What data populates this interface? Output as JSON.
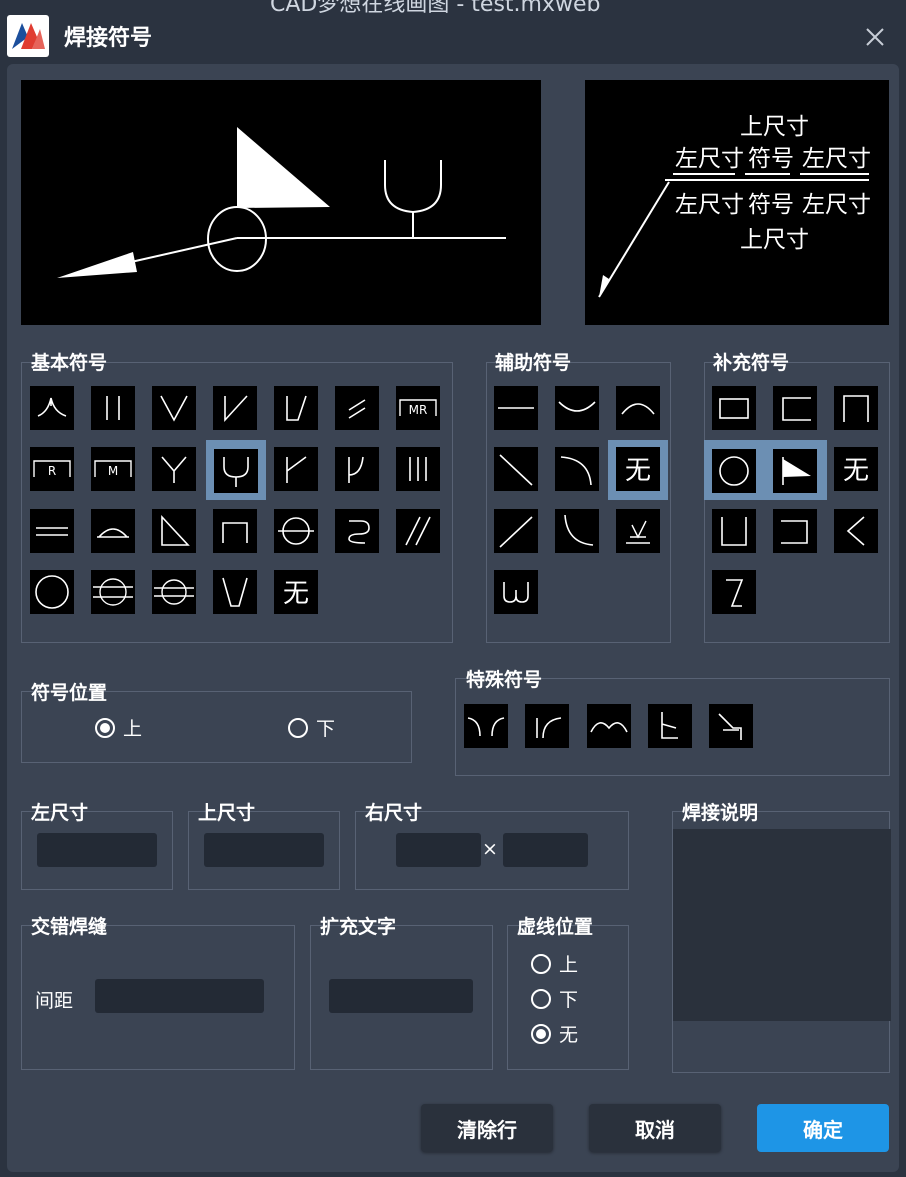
{
  "window": {
    "title": "焊接符号",
    "behind_title": "CAD梦想在线画图 - test.mxweb"
  },
  "preview_right": {
    "top": "上尺寸",
    "left_upper": "左尺寸",
    "symbol_upper": "符号",
    "right_upper": "左尺寸",
    "left_lower": "左尺寸",
    "symbol_lower": "符号",
    "right_lower": "左尺寸",
    "bottom": "上尺寸"
  },
  "groups": {
    "basic": "基本符号",
    "aux": "辅助符号",
    "supp": "补充符号",
    "position": "符号位置",
    "special": "特殊符号",
    "left_dim": "左尺寸",
    "top_dim": "上尺寸",
    "right_dim": "右尺寸",
    "desc": "焊接说明",
    "staggered": "交错焊缝",
    "ext_text": "扩充文字",
    "dash_pos": "虚线位置"
  },
  "none_glyph": "无",
  "position_options": {
    "up": "上",
    "down": "下",
    "selected": "上"
  },
  "dash_options": {
    "up": "上",
    "down": "下",
    "none": "无",
    "selected": "无"
  },
  "right_dim_times": "×",
  "staggered_spacing_label": "间距",
  "fields": {
    "left_dim": "",
    "top_dim": "",
    "right_dim_a": "",
    "right_dim_b": "",
    "spacing": "",
    "ext_text": "",
    "desc": ""
  },
  "buttons": {
    "clear": "清除行",
    "cancel": "取消",
    "ok": "确定"
  },
  "colors": {
    "accent": "#1e95e6",
    "selected": "#6c8fb3",
    "panel": "#3b4453"
  }
}
